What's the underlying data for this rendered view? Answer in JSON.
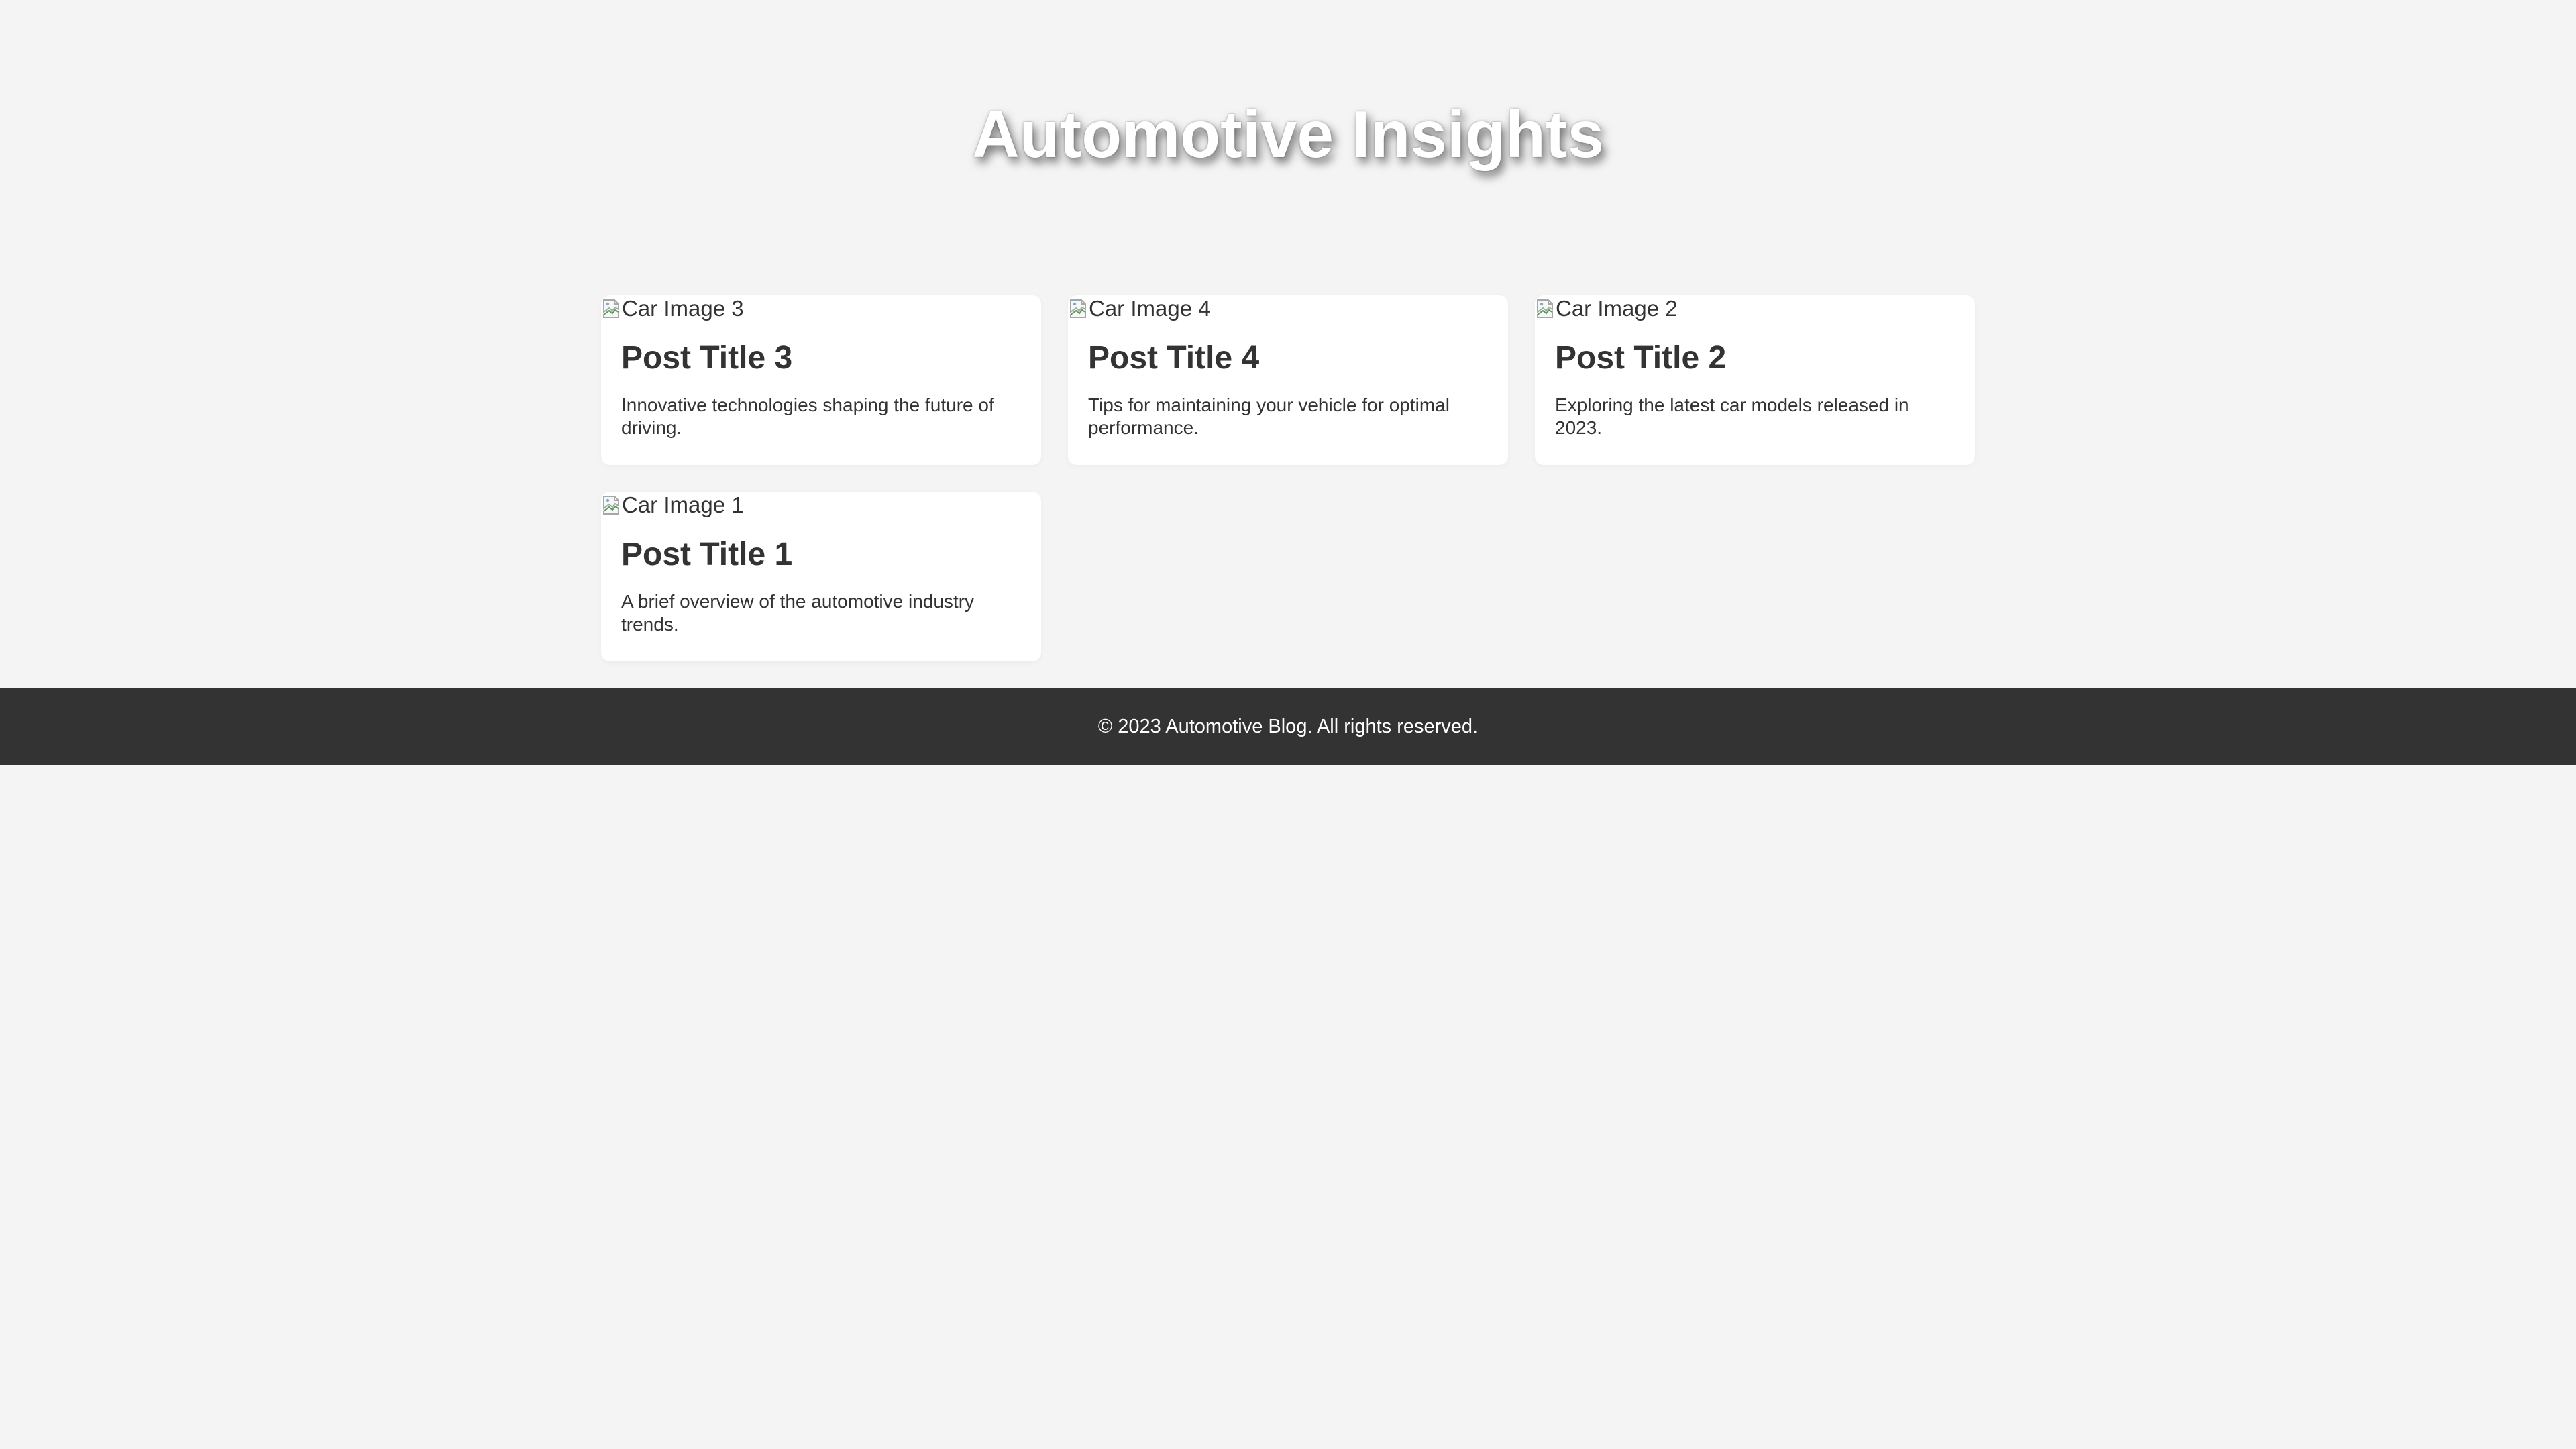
{
  "header": {
    "title": "Automotive Insights"
  },
  "posts": [
    {
      "image_alt": "Car Image 3",
      "title": "Post Title 3",
      "excerpt": "Innovative technologies shaping the future of driving."
    },
    {
      "image_alt": "Car Image 4",
      "title": "Post Title 4",
      "excerpt": "Tips for maintaining your vehicle for optimal performance."
    },
    {
      "image_alt": "Car Image 2",
      "title": "Post Title 2",
      "excerpt": "Exploring the latest car models released in 2023."
    },
    {
      "image_alt": "Car Image 1",
      "title": "Post Title 1",
      "excerpt": "A brief overview of the automotive industry trends."
    }
  ],
  "footer": {
    "copyright": "© 2023 Automotive Blog. All rights reserved."
  },
  "colors": {
    "background": "#f4f4f4",
    "card": "#ffffff",
    "text": "#333333",
    "footer": "#333333"
  }
}
